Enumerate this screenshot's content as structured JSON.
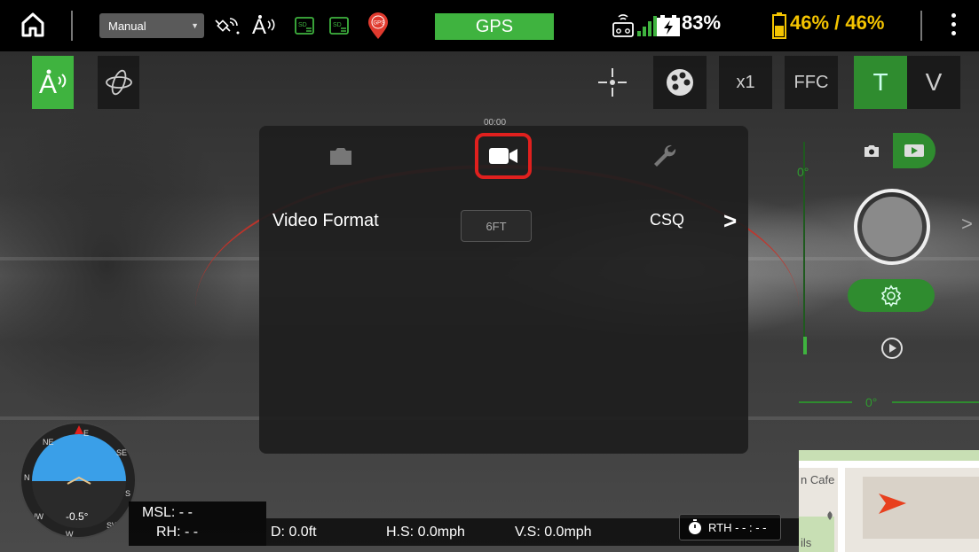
{
  "topbar": {
    "flight_mode": "Manual",
    "gps_label": "GPS",
    "battery_aircraft": "83%",
    "battery_remote": "46% / 46%",
    "icons": [
      "home-icon",
      "satellite-icon",
      "atti-icon",
      "sd-card-icon",
      "sd-card-icon",
      "gps-pin-icon",
      "remote-controller-icon",
      "signal-bars-icon",
      "battery-charging-icon",
      "battery-icon",
      "menu-dots-icon"
    ]
  },
  "toolbar2": {
    "zoom_label": "x1",
    "ffc_label": "FFC",
    "t_label": "T",
    "v_label": "V"
  },
  "panel": {
    "timer": "00:00",
    "video_format_label": "Video Format",
    "format_box": "6FT",
    "format_value": "CSQ"
  },
  "gimbal": {
    "pitch_deg": "0°",
    "yaw_deg": "0°"
  },
  "attitude": {
    "pitch": "-0.5°",
    "directions": [
      "N",
      "NE",
      "E",
      "SE",
      "S",
      "SW",
      "W",
      "NW"
    ]
  },
  "telemetry": {
    "msl": "MSL: - -",
    "rh": "RH: - -",
    "d": "D: 0.0ft",
    "hs": "H.S: 0.0mph",
    "vs": "V.S: 0.0mph",
    "rth": "RTH - - : - -"
  },
  "map": {
    "label_cafe": "n Cafe",
    "label_ils": "ils"
  },
  "colors": {
    "accent_green": "#3fb33f",
    "battery_yellow": "#f4c400",
    "highlight_red": "#e0201e"
  }
}
